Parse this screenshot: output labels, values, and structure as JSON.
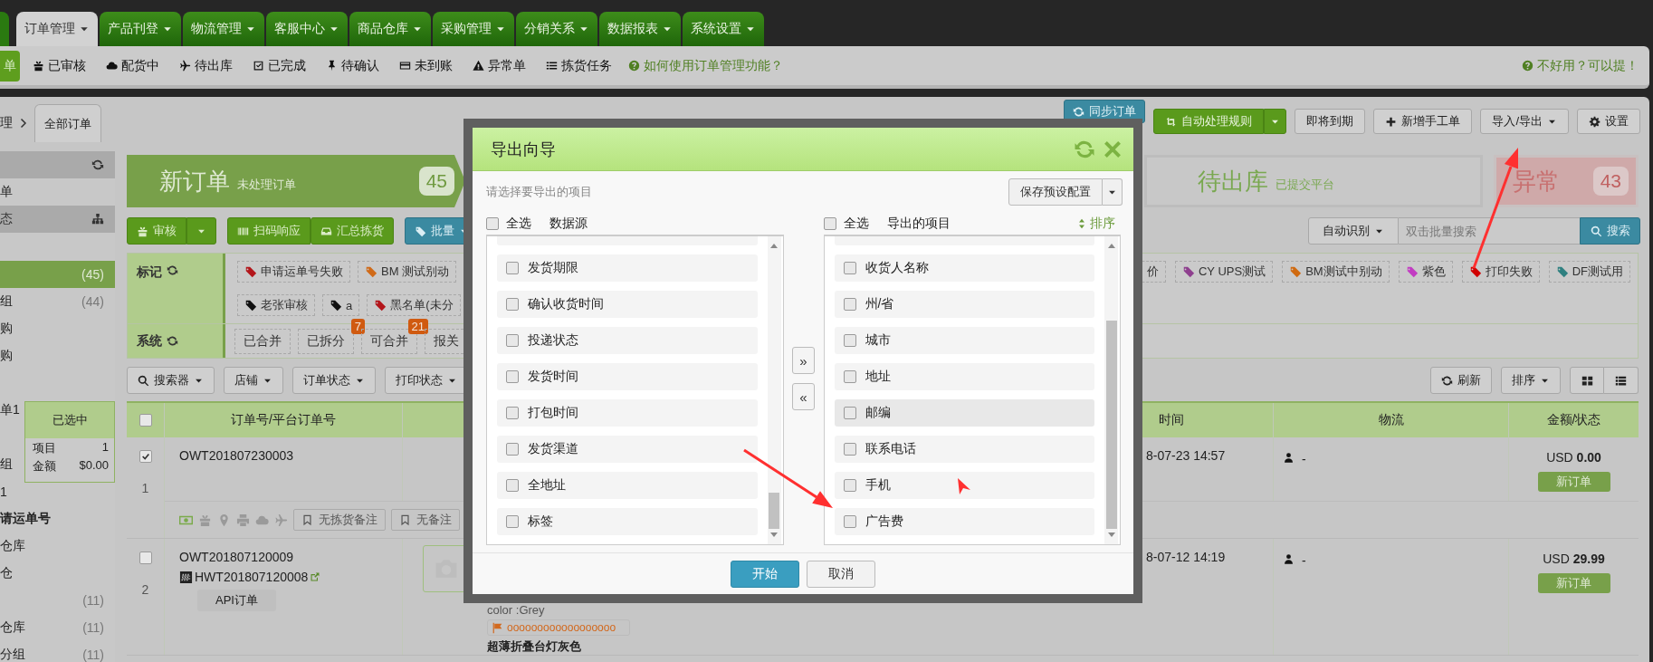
{
  "nav_tabs": [
    {
      "label": "订单管理",
      "selected": true
    },
    {
      "label": "产品刊登",
      "selected": false
    },
    {
      "label": "物流管理",
      "selected": false
    },
    {
      "label": "客服中心",
      "selected": false
    },
    {
      "label": "商品仓库",
      "selected": false
    },
    {
      "label": "采购管理",
      "selected": false
    },
    {
      "label": "分销关系",
      "selected": false
    },
    {
      "label": "数据报表",
      "selected": false
    },
    {
      "label": "系统设置",
      "selected": false
    }
  ],
  "sub_nav": {
    "items": [
      {
        "label": "单",
        "selected": true
      },
      {
        "label": "已审核",
        "selected": false
      },
      {
        "label": "配货中",
        "selected": false
      },
      {
        "label": "待出库",
        "selected": false
      },
      {
        "label": "已完成",
        "selected": false
      },
      {
        "label": "待确认",
        "selected": false
      },
      {
        "label": "未到账",
        "selected": false
      },
      {
        "label": "异常单",
        "selected": false
      },
      {
        "label": "拣货任务",
        "selected": false
      }
    ],
    "help_link": "如何使用订单管理功能？",
    "feedback_link": "不好用？可以提！"
  },
  "breadcrumb": {
    "parent": "理",
    "tab": "全部订单"
  },
  "header_buttons": [
    {
      "label": "同步订单",
      "kind": "primary"
    },
    {
      "label": "自动处理规则",
      "kind": "split"
    },
    {
      "label": "即将到期",
      "kind": "plain"
    },
    {
      "label": "新增手工单",
      "kind": "plain"
    },
    {
      "label": "导入/导出",
      "kind": "dropdown"
    },
    {
      "label": "设置",
      "kind": "plain"
    }
  ],
  "sidebar": {
    "items": [
      {
        "kind": "header"
      },
      {
        "kind": "item",
        "label": "单",
        "selected": false
      },
      {
        "kind": "header",
        "label": "态"
      },
      {
        "kind": "gap"
      },
      {
        "kind": "item",
        "count": "(45)",
        "selected": true
      },
      {
        "kind": "item",
        "label": "组",
        "count": "(44)",
        "selected": false
      },
      {
        "kind": "item",
        "label": "购",
        "selected": false
      },
      {
        "kind": "item",
        "label": "购",
        "selected": false
      },
      {
        "kind": "gap"
      },
      {
        "kind": "item",
        "label": "单1",
        "selected": false
      },
      {
        "kind": "gap"
      },
      {
        "kind": "item",
        "label": "组",
        "selected": false
      },
      {
        "kind": "item",
        "label": "1",
        "selected": false
      },
      {
        "kind": "group",
        "label": "请运单号"
      },
      {
        "kind": "item",
        "label": "仓库",
        "selected": false
      },
      {
        "kind": "item",
        "label": "仓",
        "selected": false
      },
      {
        "kind": "item",
        "count": "(11)",
        "selected": false
      },
      {
        "kind": "item",
        "label": "仓库",
        "count": "(11)",
        "selected": false
      },
      {
        "kind": "item",
        "label": "分组",
        "count": "(11)",
        "selected": false
      }
    ]
  },
  "selection_summary": {
    "title": "已选中",
    "rows": [
      {
        "label": "项目",
        "value": "1"
      },
      {
        "label": "金额",
        "value": "$0.00"
      }
    ]
  },
  "status_cards": [
    {
      "kind": "new",
      "title": "新订单",
      "subtitle": "未处理订单",
      "count": "45"
    },
    {
      "kind": "pending",
      "title": "待出库",
      "subtitle": "已提交平台"
    },
    {
      "kind": "error",
      "title": "异常",
      "count": "43"
    }
  ],
  "toolbar": {
    "review": "审核",
    "scan": "扫码响应",
    "pick": "汇总拣货",
    "batch": "批量",
    "search_mode": "自动识别",
    "search_placeholder": "双击批量搜索",
    "search_button": "搜索"
  },
  "tags": {
    "mark_label": "标记",
    "mark_rows": [
      {
        "left": [
          {
            "label": "申请运单号失败",
            "color": "#b3161b"
          },
          {
            "label": "BM 测试别动",
            "color": "#d06a18"
          }
        ],
        "right": [
          {
            "label": "价"
          },
          {
            "label": "CY UPS测试",
            "color": "#8e3f8e"
          },
          {
            "label": "BM测试中别动",
            "color": "#d06a10"
          },
          {
            "label": "紫色",
            "color": "#c23cc2"
          },
          {
            "label": "打印失败",
            "color": "#d00000"
          },
          {
            "label": "DF测试用",
            "color": "#2f8080"
          }
        ]
      },
      {
        "left": [
          {
            "label": "老张审核",
            "color": "#111111"
          },
          {
            "label": "a",
            "color": "#111111"
          },
          {
            "label": "黑名单(未分",
            "color": "#b3161b"
          }
        ],
        "right": []
      }
    ],
    "system_label": "系统",
    "system": [
      {
        "label": "已合并"
      },
      {
        "label": "已拆分",
        "badge": "7"
      },
      {
        "label": "可合并",
        "badge": "21"
      },
      {
        "label": "报关"
      }
    ]
  },
  "filters": {
    "items": [
      "搜索器",
      "店铺",
      "订单状态",
      "打印状态"
    ],
    "refresh": "刷新",
    "sort": "排序"
  },
  "orders": {
    "columns": {
      "order": "订单号/平台订单号",
      "time": "时间",
      "logistics": "物流",
      "amount": "金额/状态"
    },
    "select_all_checked": false,
    "rows": [
      {
        "checked": true,
        "index": "1",
        "order_no": "OWT201807230003",
        "time": "8-07-23 14:57",
        "logistics": "-",
        "amount": "USD **0.00**",
        "status": "新订单",
        "notes": [
          "无拣货备注",
          "无备注"
        ]
      },
      {
        "checked": false,
        "index": "2",
        "order_no": "OWT201807120009",
        "platform_no": "HWT201807120008",
        "source": "API订单",
        "variant": "color :Grey",
        "sku": "oooooooooooooooooo",
        "product": "超薄折叠台灯灰色",
        "time": "8-07-12 14:19",
        "logistics": "-",
        "amount": "USD **29.99**",
        "status": "新订单"
      }
    ]
  },
  "export_dialog": {
    "title": "导出向导",
    "hint": "请选择要导出的项目",
    "save_preset": "保存预设配置",
    "source": {
      "select_all": "全选",
      "select_all_checked": false,
      "title": "数据源",
      "items": [
        {
          "label": "发货期限",
          "checked": false
        },
        {
          "label": "确认收货时间",
          "checked": false
        },
        {
          "label": "投递状态",
          "checked": false
        },
        {
          "label": "发货时间",
          "checked": false
        },
        {
          "label": "打包时间",
          "checked": false
        },
        {
          "label": "发货渠道",
          "checked": false
        },
        {
          "label": "全地址",
          "checked": false
        },
        {
          "label": "标签",
          "checked": false
        }
      ]
    },
    "target": {
      "select_all": "全选",
      "select_all_checked": false,
      "title": "导出的项目",
      "sort": "排序",
      "items": [
        {
          "label": "收货人名称",
          "checked": false,
          "hovered": false
        },
        {
          "label": "州/省",
          "checked": false,
          "hovered": false
        },
        {
          "label": "城市",
          "checked": false,
          "hovered": false
        },
        {
          "label": "地址",
          "checked": false,
          "hovered": false
        },
        {
          "label": "邮编",
          "checked": false,
          "hovered": true
        },
        {
          "label": "联系电话",
          "checked": false,
          "hovered": false
        },
        {
          "label": "手机",
          "checked": false,
          "hovered": false
        },
        {
          "label": "广告费",
          "checked": false,
          "hovered": false
        }
      ]
    },
    "move_right": "»",
    "move_left": "«",
    "start": "开始",
    "cancel": "取消"
  }
}
